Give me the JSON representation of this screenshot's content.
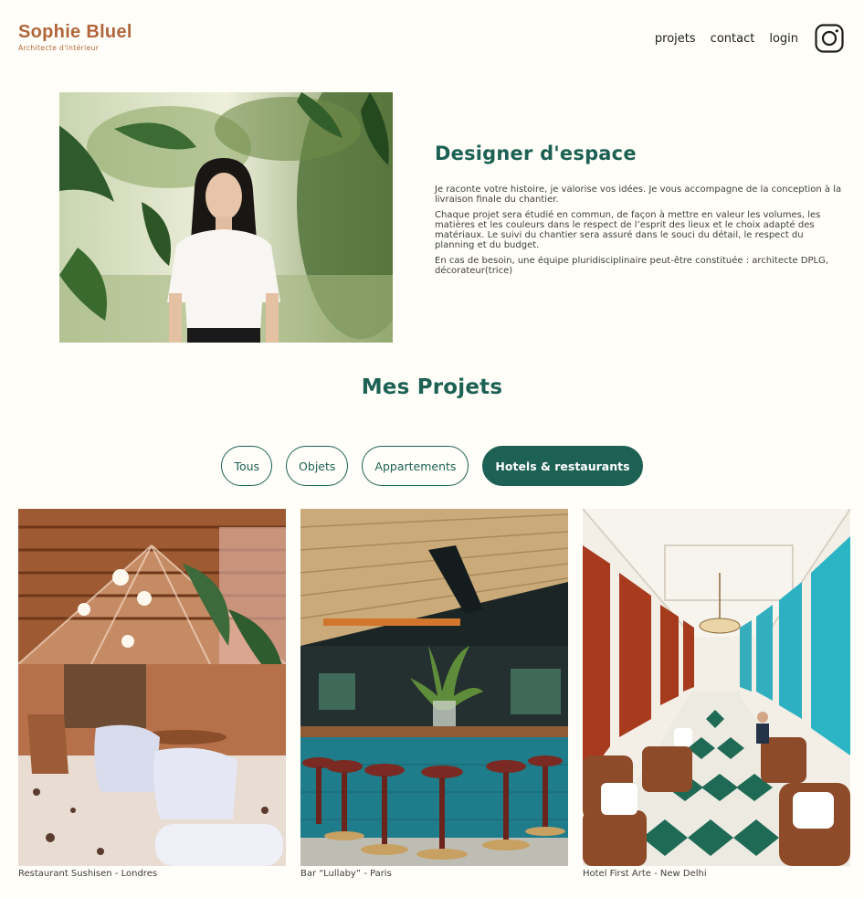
{
  "header": {
    "logo_title": "Sophie Bluel",
    "logo_subtitle": "Architecte d'intérieur",
    "nav": [
      "projets",
      "contact",
      "login"
    ],
    "instagram_icon": "instagram-icon"
  },
  "about": {
    "title": "Designer d'espace",
    "paragraphs": [
      "Je raconte votre histoire, je valorise vos idées. Je vous accompagne de la conception à la livraison finale du chantier.",
      "Chaque projet sera étudié en commun, de façon à mettre en valeur les volumes, les matières et les couleurs dans le respect de l’esprit des lieux et le choix adapté des matériaux. Le suivi du chantier sera assuré dans le souci du détail, le respect du planning et du budget.",
      "En cas de besoin, une équipe pluridisciplinaire peut-être constituée : architecte DPLG, décorateur(trice)"
    ]
  },
  "projects": {
    "title": "Mes Projets",
    "filters": [
      "Tous",
      "Objets",
      "Appartements",
      "Hotels & restaurants"
    ],
    "active_filter": "Hotels & restaurants",
    "items": [
      {
        "caption": "Restaurant Sushisen - Londres"
      },
      {
        "caption": "Bar “Lullaby” - Paris"
      },
      {
        "caption": "Hotel First Arte - New Delhi"
      }
    ]
  },
  "colors": {
    "brand": "#B1663C",
    "accent": "#1D6154",
    "background": "#FFFEF8"
  }
}
